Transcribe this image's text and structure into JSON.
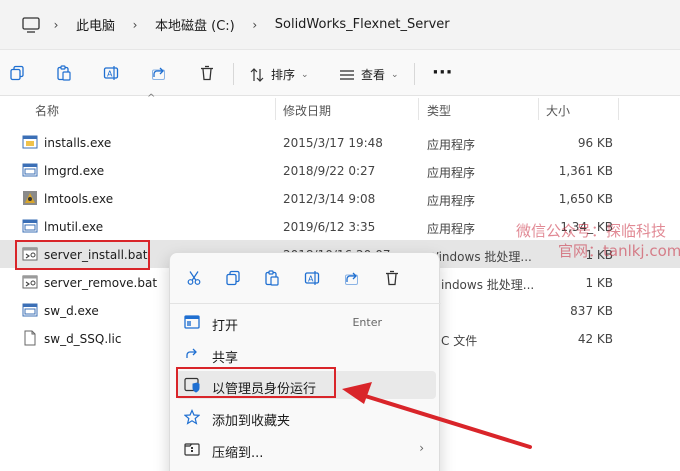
{
  "address_bar": {
    "crumbs": [
      "此电脑",
      "本地磁盘 (C:)",
      "SolidWorks_Flexnet_Server"
    ]
  },
  "toolbar": {
    "sort_label": "排序",
    "view_label": "查看",
    "more_label": "···"
  },
  "columns": {
    "name": "名称",
    "modified": "修改日期",
    "type": "类型",
    "size": "大小"
  },
  "files": [
    {
      "name": "installs.exe",
      "date": "2015/3/17 19:48",
      "type": "应用程序",
      "size": "96 KB",
      "icon": "exe-icon"
    },
    {
      "name": "lmgrd.exe",
      "date": "2018/9/22 0:27",
      "type": "应用程序",
      "size": "1,361 KB",
      "icon": "exe-icon"
    },
    {
      "name": "lmtools.exe",
      "date": "2012/3/14 9:08",
      "type": "应用程序",
      "size": "1,650 KB",
      "icon": "lmtools-icon"
    },
    {
      "name": "lmutil.exe",
      "date": "2019/6/12 3:35",
      "type": "应用程序",
      "size": "1,34_ KB",
      "icon": "exe-icon"
    },
    {
      "name": "server_install.bat",
      "date": "2018/10/16 20:07",
      "type": "Windows 批处理...",
      "size": "1 KB",
      "icon": "bat-icon"
    },
    {
      "name": "server_remove.bat",
      "date": "",
      "type": "indows 批处理...",
      "size": "1 KB",
      "icon": "bat-icon"
    },
    {
      "name": "sw_d.exe",
      "date": "",
      "type": "",
      "size": "837 KB",
      "icon": "exe-icon"
    },
    {
      "name": "sw_d_SSQ.lic",
      "date": "",
      "type": "C 文件",
      "size": "42 KB",
      "icon": "file-icon"
    }
  ],
  "context_menu": {
    "items": [
      {
        "label": "打开",
        "shortcut": "Enter",
        "icon": "open-icon"
      },
      {
        "label": "共享",
        "shortcut": "",
        "icon": "share-icon"
      },
      {
        "label": "以管理员身份运行",
        "shortcut": "",
        "icon": "shield-icon"
      },
      {
        "label": "添加到收藏夹",
        "shortcut": "",
        "icon": "star-icon"
      },
      {
        "label": "压缩到...",
        "shortcut": "",
        "icon": "zip-icon",
        "has_submenu": true
      }
    ]
  },
  "watermark": {
    "line1": "微信公众号：探临科技",
    "line2": "官网：tanlkj.com"
  },
  "colors": {
    "highlight_red": "#d9252a",
    "accent_blue": "#1f6fd1"
  }
}
